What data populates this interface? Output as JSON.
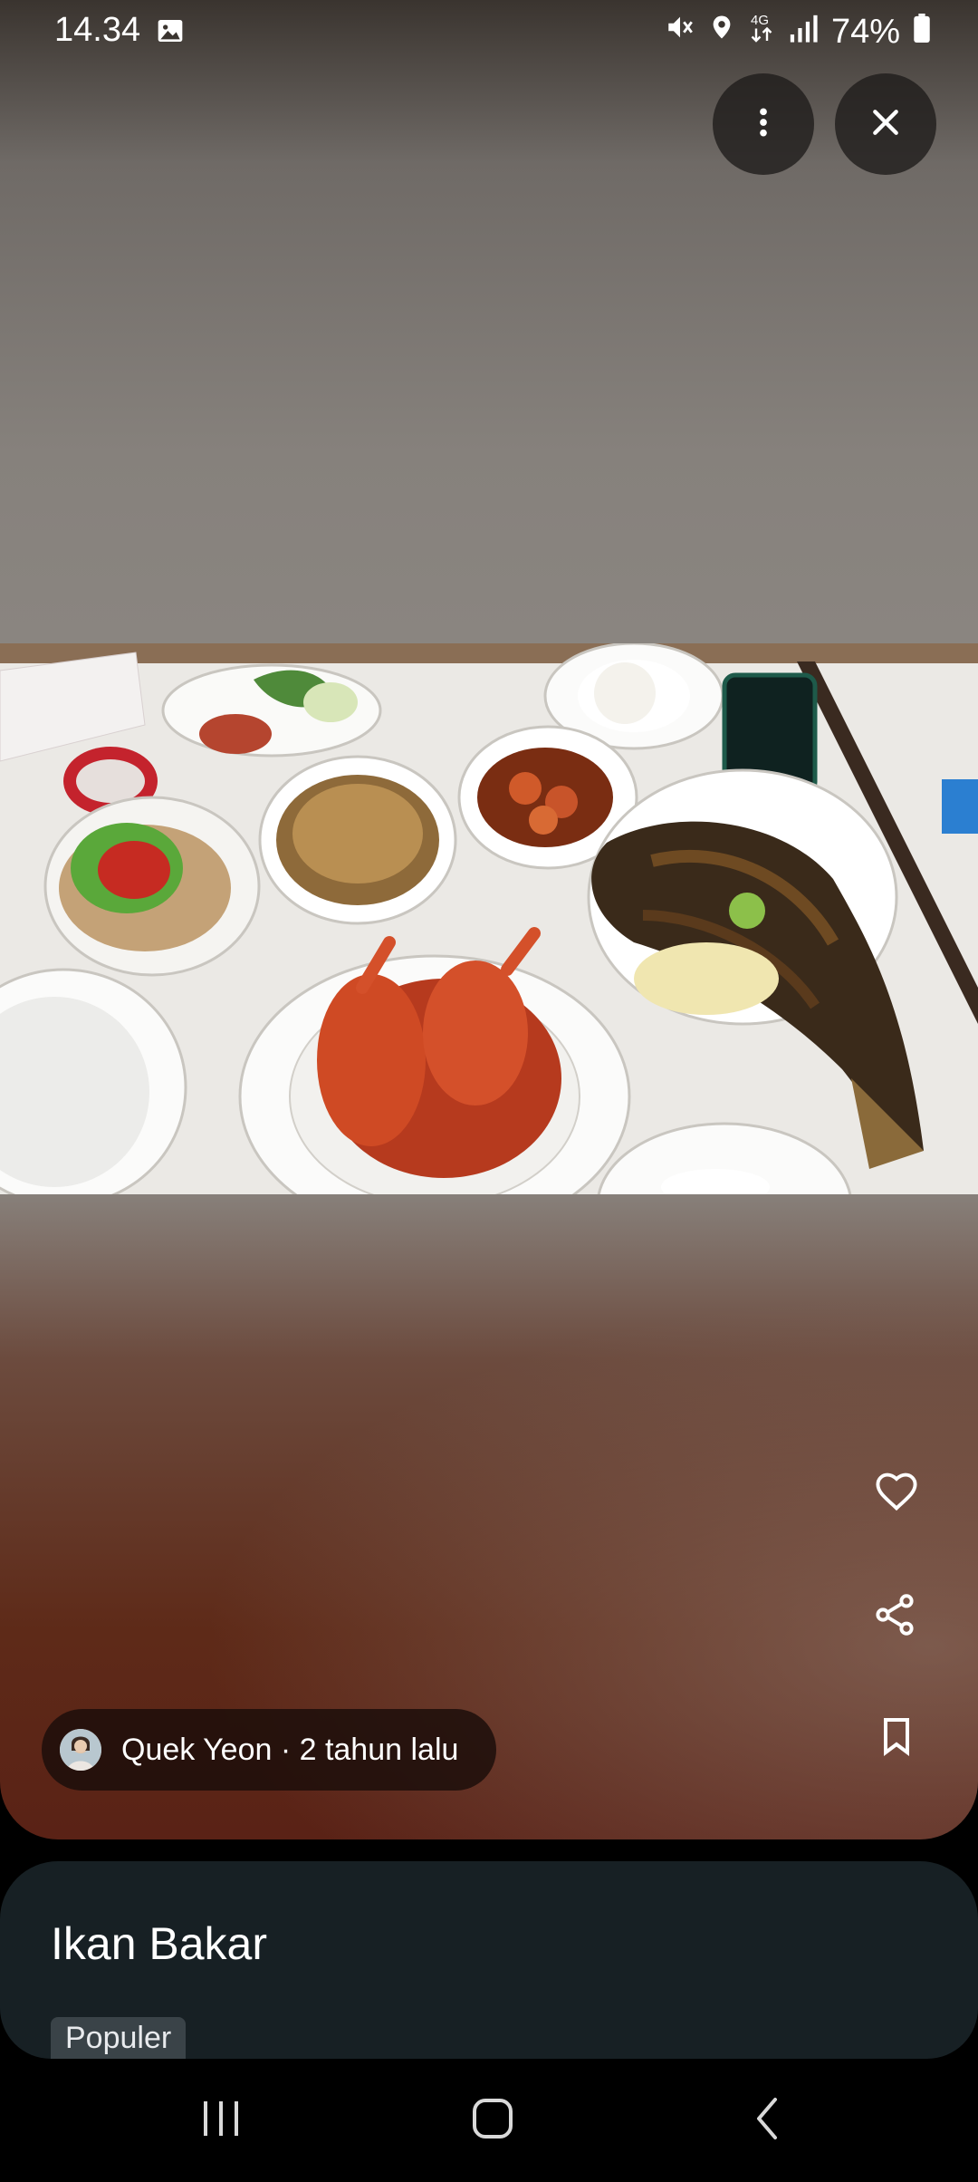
{
  "status_bar": {
    "time": "14.34",
    "battery": "74%",
    "icons": [
      "gallery-icon",
      "mute-icon",
      "location-icon",
      "4g-icon",
      "signal-icon",
      "battery-icon"
    ]
  },
  "top_actions": {
    "more": "more-vert-icon",
    "close": "close-icon"
  },
  "side_actions": [
    "heart-icon",
    "share-icon",
    "bookmark-icon"
  ],
  "author": {
    "text": "Quek Yeon · 2 tahun lalu"
  },
  "dish": {
    "title": "Ikan Bakar",
    "tag": "Populer"
  },
  "navigation": [
    "recents-icon",
    "home-icon",
    "back-icon"
  ],
  "colors": {
    "sheet_bg": "#172024",
    "chip_bg": "#3a4348",
    "overlay_btn": "#1e1b19"
  }
}
